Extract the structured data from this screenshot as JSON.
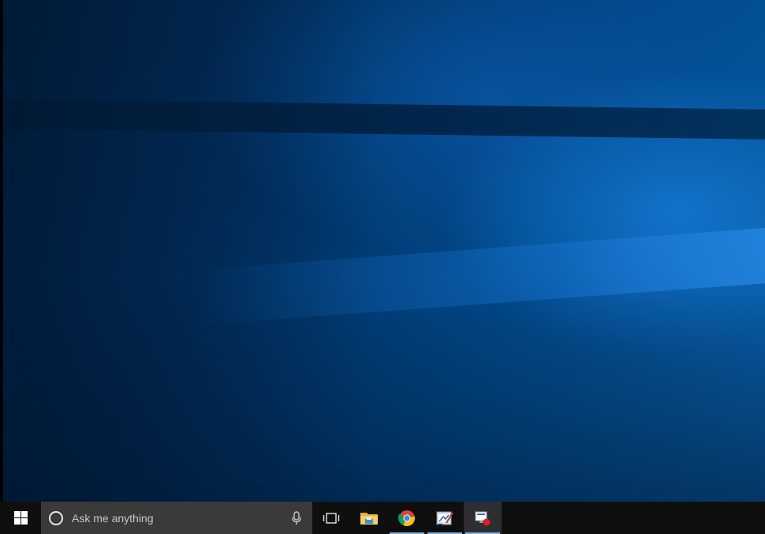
{
  "taskbar": {
    "search": {
      "placeholder": "Ask me anything"
    },
    "apps": [
      {
        "icon": "file-explorer-icon",
        "running": false
      },
      {
        "icon": "chrome-icon",
        "running": true
      },
      {
        "icon": "paint-app-icon",
        "running": true
      },
      {
        "icon": "screen-recorder-icon",
        "running": true,
        "active": true
      }
    ]
  },
  "colors": {
    "taskbar": "#0f0f10",
    "search_box": "#3a3a3a",
    "running_indicator": "#7ab4e6",
    "wallpaper_accent": "#0a63b0"
  }
}
